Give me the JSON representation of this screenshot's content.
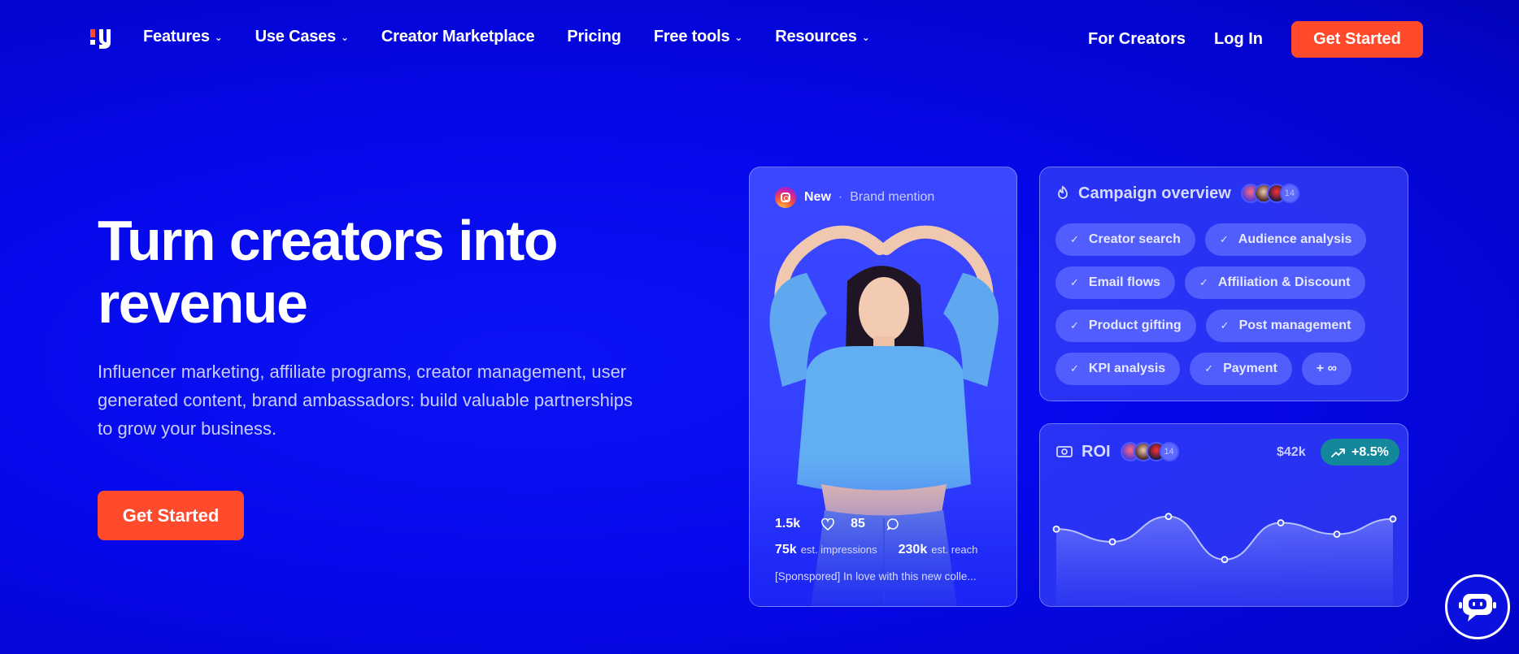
{
  "nav": {
    "items": [
      {
        "label": "Features",
        "dropdown": true
      },
      {
        "label": "Use Cases",
        "dropdown": true
      },
      {
        "label": "Creator Marketplace",
        "dropdown": false
      },
      {
        "label": "Pricing",
        "dropdown": false
      },
      {
        "label": "Free tools",
        "dropdown": true
      },
      {
        "label": "Resources",
        "dropdown": true
      }
    ],
    "for_creators": "For Creators",
    "login": "Log In",
    "cta": "Get Started"
  },
  "hero": {
    "title": "Turn creators into revenue",
    "subtitle": "Influencer marketing, affiliate programs, creator management, user generated content, brand ambassadors: build valuable partnerships to grow your business.",
    "cta": "Get Started"
  },
  "post": {
    "badge": "New",
    "separator": "·",
    "type": "Brand mention",
    "likes": "1.5k",
    "comments": "85",
    "impressions_value": "75k",
    "impressions_label": "est. impressions",
    "reach_value": "230k",
    "reach_label": "est. reach",
    "caption": "[Sponspored] In love with this new colle..."
  },
  "campaign": {
    "title": "Campaign overview",
    "avatar_count": "14",
    "chips": [
      "Creator search",
      "Audience analysis",
      "Email flows",
      "Affiliation & Discount",
      "Product gifting",
      "Post management",
      "KPI analysis",
      "Payment",
      "+ ∞"
    ]
  },
  "roi": {
    "title": "ROI",
    "avatar_count": "14",
    "amount": "$42k",
    "change": "+8.5%",
    "series": [
      0.62,
      0.52,
      0.72,
      0.38,
      0.67,
      0.58,
      0.7
    ]
  },
  "colors": {
    "background": "#0608ea",
    "accent": "#ff4a2b",
    "badge": "#13889a"
  },
  "icons": [
    "logo-icon",
    "chevron-down-icon",
    "instagram-icon",
    "heart-icon",
    "comment-icon",
    "check-icon",
    "campaign-icon",
    "roi-icon",
    "trend-up-icon",
    "chatbot-icon"
  ]
}
